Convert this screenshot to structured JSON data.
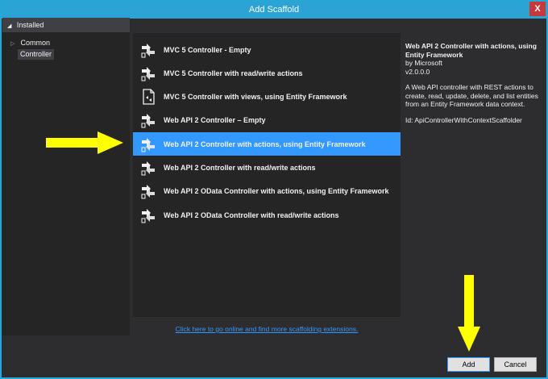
{
  "window": {
    "title": "Add Scaffold",
    "close_glyph": "X"
  },
  "left_panel": {
    "header": "Installed",
    "tree": [
      {
        "label": "Common"
      },
      {
        "label": "Controller"
      }
    ]
  },
  "scaffolds": [
    {
      "label": "MVC 5 Controller - Empty",
      "icon": "scaffold-arrows-icon"
    },
    {
      "label": "MVC 5 Controller with read/write actions",
      "icon": "scaffold-arrows-icon"
    },
    {
      "label": "MVC 5 Controller with views, using Entity Framework",
      "icon": "scaffold-page-icon"
    },
    {
      "label": "Web API 2 Controller – Empty",
      "icon": "scaffold-arrows-icon"
    },
    {
      "label": "Web API 2 Controller with actions, using Entity Framework",
      "icon": "scaffold-arrows-icon",
      "selected": true
    },
    {
      "label": "Web API 2 Controller with read/write actions",
      "icon": "scaffold-arrows-icon"
    },
    {
      "label": "Web API 2 OData Controller with actions, using Entity Framework",
      "icon": "scaffold-arrows-icon"
    },
    {
      "label": "Web API 2 OData Controller with read/write actions",
      "icon": "scaffold-arrows-icon"
    }
  ],
  "details": {
    "title_line1": "Web API 2 Controller with actions, using",
    "title_line2": "Entity Framework",
    "author": "by Microsoft",
    "version": "v2.0.0.0",
    "description_line1": "A Web API controller with REST actions to",
    "description_line2": "create, read, update, delete, and list entities",
    "description_line3": "from an Entity Framework data context.",
    "id": "Id: ApiControllerWithContextScaffolder"
  },
  "online_link": "Click here to go online and find more scaffolding extensions.",
  "buttons": {
    "add": "Add",
    "cancel": "Cancel"
  },
  "colors": {
    "accent": "#2ba3d5",
    "selection": "#3399ff",
    "annotation_arrow": "#ffff00",
    "background": "#2d2d30"
  }
}
